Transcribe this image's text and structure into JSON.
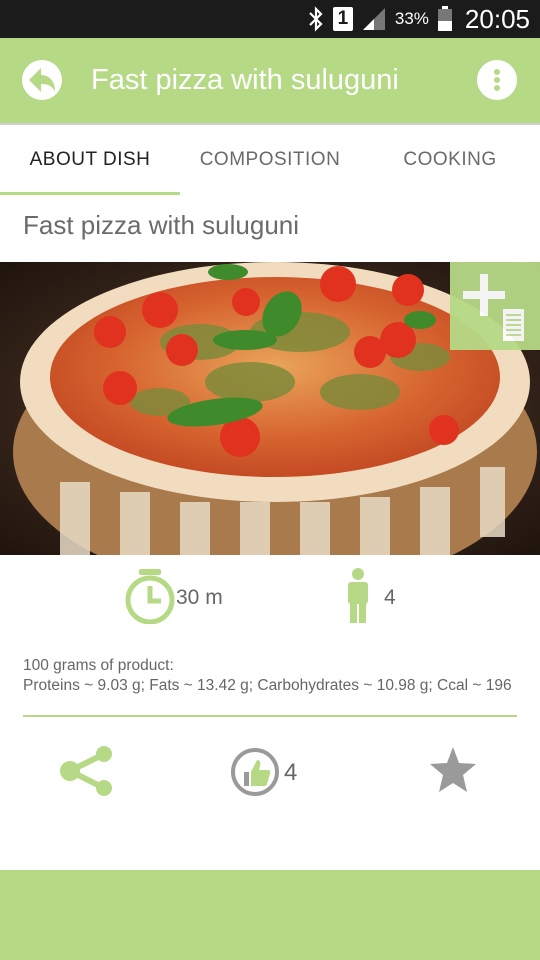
{
  "status_bar": {
    "sim_slot": "1",
    "battery_percent": "33%",
    "time": "20:05"
  },
  "app_bar": {
    "title": "Fast pizza with suluguni",
    "back_icon": "back-arrow-icon",
    "menu_icon": "more-vert-icon"
  },
  "tabs": [
    {
      "label": "ABOUT DISH",
      "active": true
    },
    {
      "label": "COMPOSITION",
      "active": false
    },
    {
      "label": "COOKING",
      "active": false
    }
  ],
  "dish": {
    "title": "Fast pizza with suluguni",
    "image_icon": "pizza-photo",
    "add_to_list_icon": "add-to-list-icon"
  },
  "info": {
    "cook_time": "30 m",
    "servings": "4"
  },
  "nutrition": {
    "heading": "100 grams of product:",
    "details": "Proteins ~ 9.03 g; Fats ~ 13.42 g; Carbohydrates ~ 10.98 g; Ccal ~ 196"
  },
  "actions": {
    "likes": "4"
  },
  "colors": {
    "accent": "#b6d985",
    "status_bar": "#1b1b1b",
    "text": "#666666"
  }
}
